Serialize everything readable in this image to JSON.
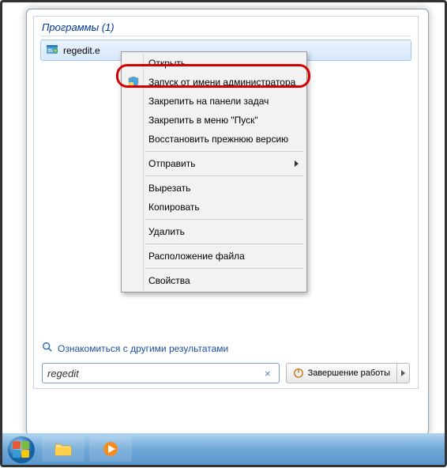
{
  "section_title": "Программы (1)",
  "result_item": "regedit.e",
  "context_menu": {
    "open": "Открыть",
    "run_admin": "Запуск от имени администратора",
    "pin_taskbar": "Закрепить на панели задач",
    "pin_start": "Закрепить в меню \"Пуск\"",
    "restore_prev": "Восстановить прежнюю версию",
    "send_to": "Отправить",
    "cut": "Вырезать",
    "copy": "Копировать",
    "delete": "Удалить",
    "file_location": "Расположение файла",
    "properties": "Свойства"
  },
  "other_results": "Ознакомиться с другими результатами",
  "search_value": "regedit",
  "shutdown_label": "Завершение работы",
  "icons": {
    "regedit": "regedit-icon",
    "shield": "shield-icon",
    "magnify": "magnify-icon",
    "clear": "×"
  }
}
